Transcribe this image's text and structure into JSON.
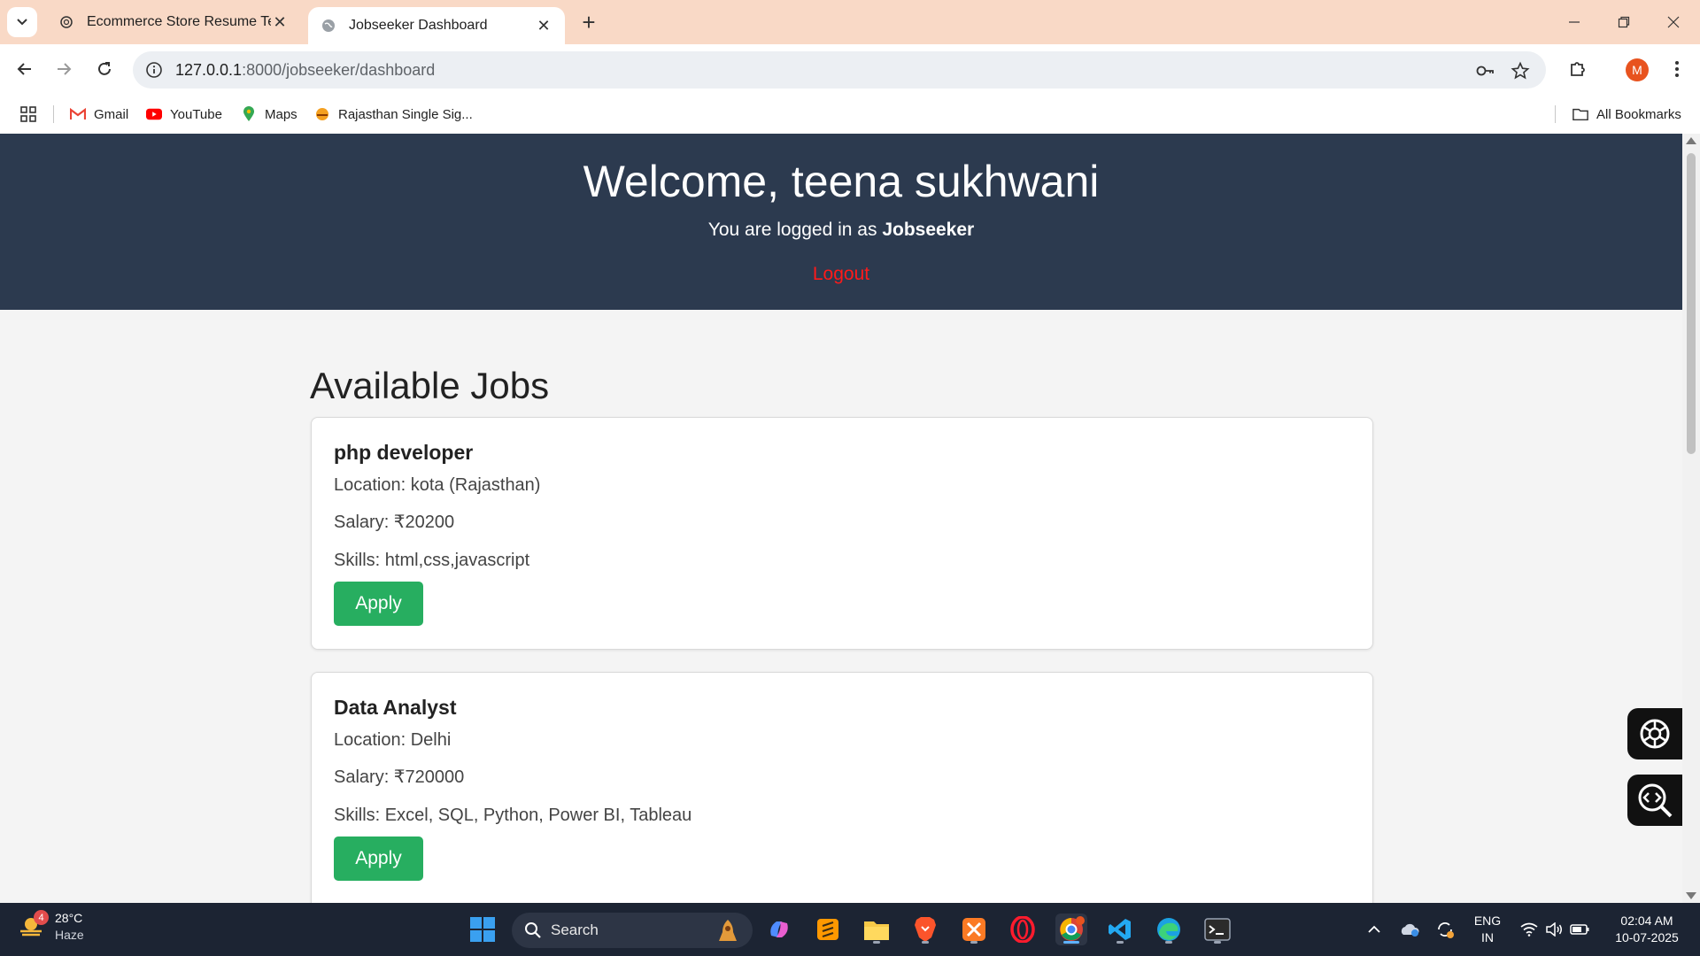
{
  "browser": {
    "tabs": [
      {
        "title": "Ecommerce Store Resume Temp",
        "active": false
      },
      {
        "title": "Jobseeker Dashboard",
        "active": true
      }
    ],
    "url_host": "127.0.0.1",
    "url_path": ":8000/jobseeker/dashboard",
    "profile_initial": "M",
    "bookmarks": [
      {
        "label": "Gmail",
        "icon": "gmail-icon"
      },
      {
        "label": "YouTube",
        "icon": "youtube-icon"
      },
      {
        "label": "Maps",
        "icon": "maps-icon"
      },
      {
        "label": "Rajasthan Single Sig...",
        "icon": "emblem-icon"
      }
    ],
    "all_bookmarks_label": "All Bookmarks"
  },
  "header": {
    "welcome": "Welcome, teena sukhwani",
    "logged_in_prefix": "You are logged in as ",
    "role": "Jobseeker",
    "logout_label": "Logout"
  },
  "jobs_section": {
    "title": "Available Jobs",
    "jobs": [
      {
        "title": "php developer",
        "location": "Location: kota (Rajasthan)",
        "salary": "Salary: ₹20200",
        "skills": "Skills: html,css,javascript",
        "apply_label": "Apply"
      },
      {
        "title": "Data Analyst",
        "location": "Location: Delhi",
        "salary": "Salary: ₹720000",
        "skills": "Skills: Excel, SQL, Python, Power BI, Tableau",
        "apply_label": "Apply"
      }
    ]
  },
  "taskbar": {
    "weather_badge": "4",
    "temperature": "28°C",
    "condition": "Haze",
    "search_placeholder": "Search",
    "lang_line1": "ENG",
    "lang_line2": "IN",
    "time": "02:04 AM",
    "date": "10-07-2025"
  },
  "colors": {
    "header_bg": "#2c3a4f",
    "logout": "#ff1a1a",
    "apply_button": "#27ae60",
    "tab_strip": "#f9d9c6"
  }
}
